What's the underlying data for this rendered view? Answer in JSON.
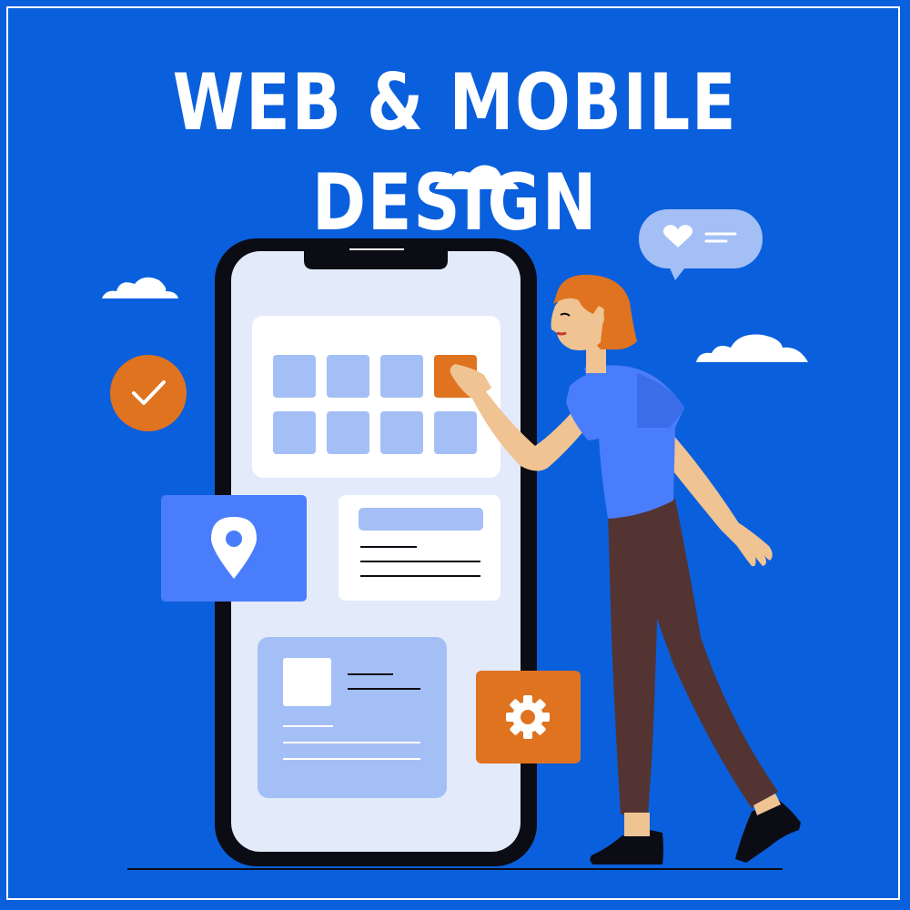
{
  "headline": "WEB & MOBILE DESIGN",
  "colors": {
    "background": "#0a5fdc",
    "phone_screen": "#e3eafa",
    "tile": "#a4bff5",
    "accent_orange": "#df7320",
    "card_blue": "#4a7dfb",
    "phone_body": "#0c0c14"
  },
  "icons": [
    "cloud-icon",
    "heart-chat-icon",
    "check-icon",
    "location-pin-icon",
    "gear-icon"
  ],
  "phone": {
    "grid_rows": 2,
    "grid_cols": 4,
    "highlighted_tile": "row 1, col 4"
  }
}
